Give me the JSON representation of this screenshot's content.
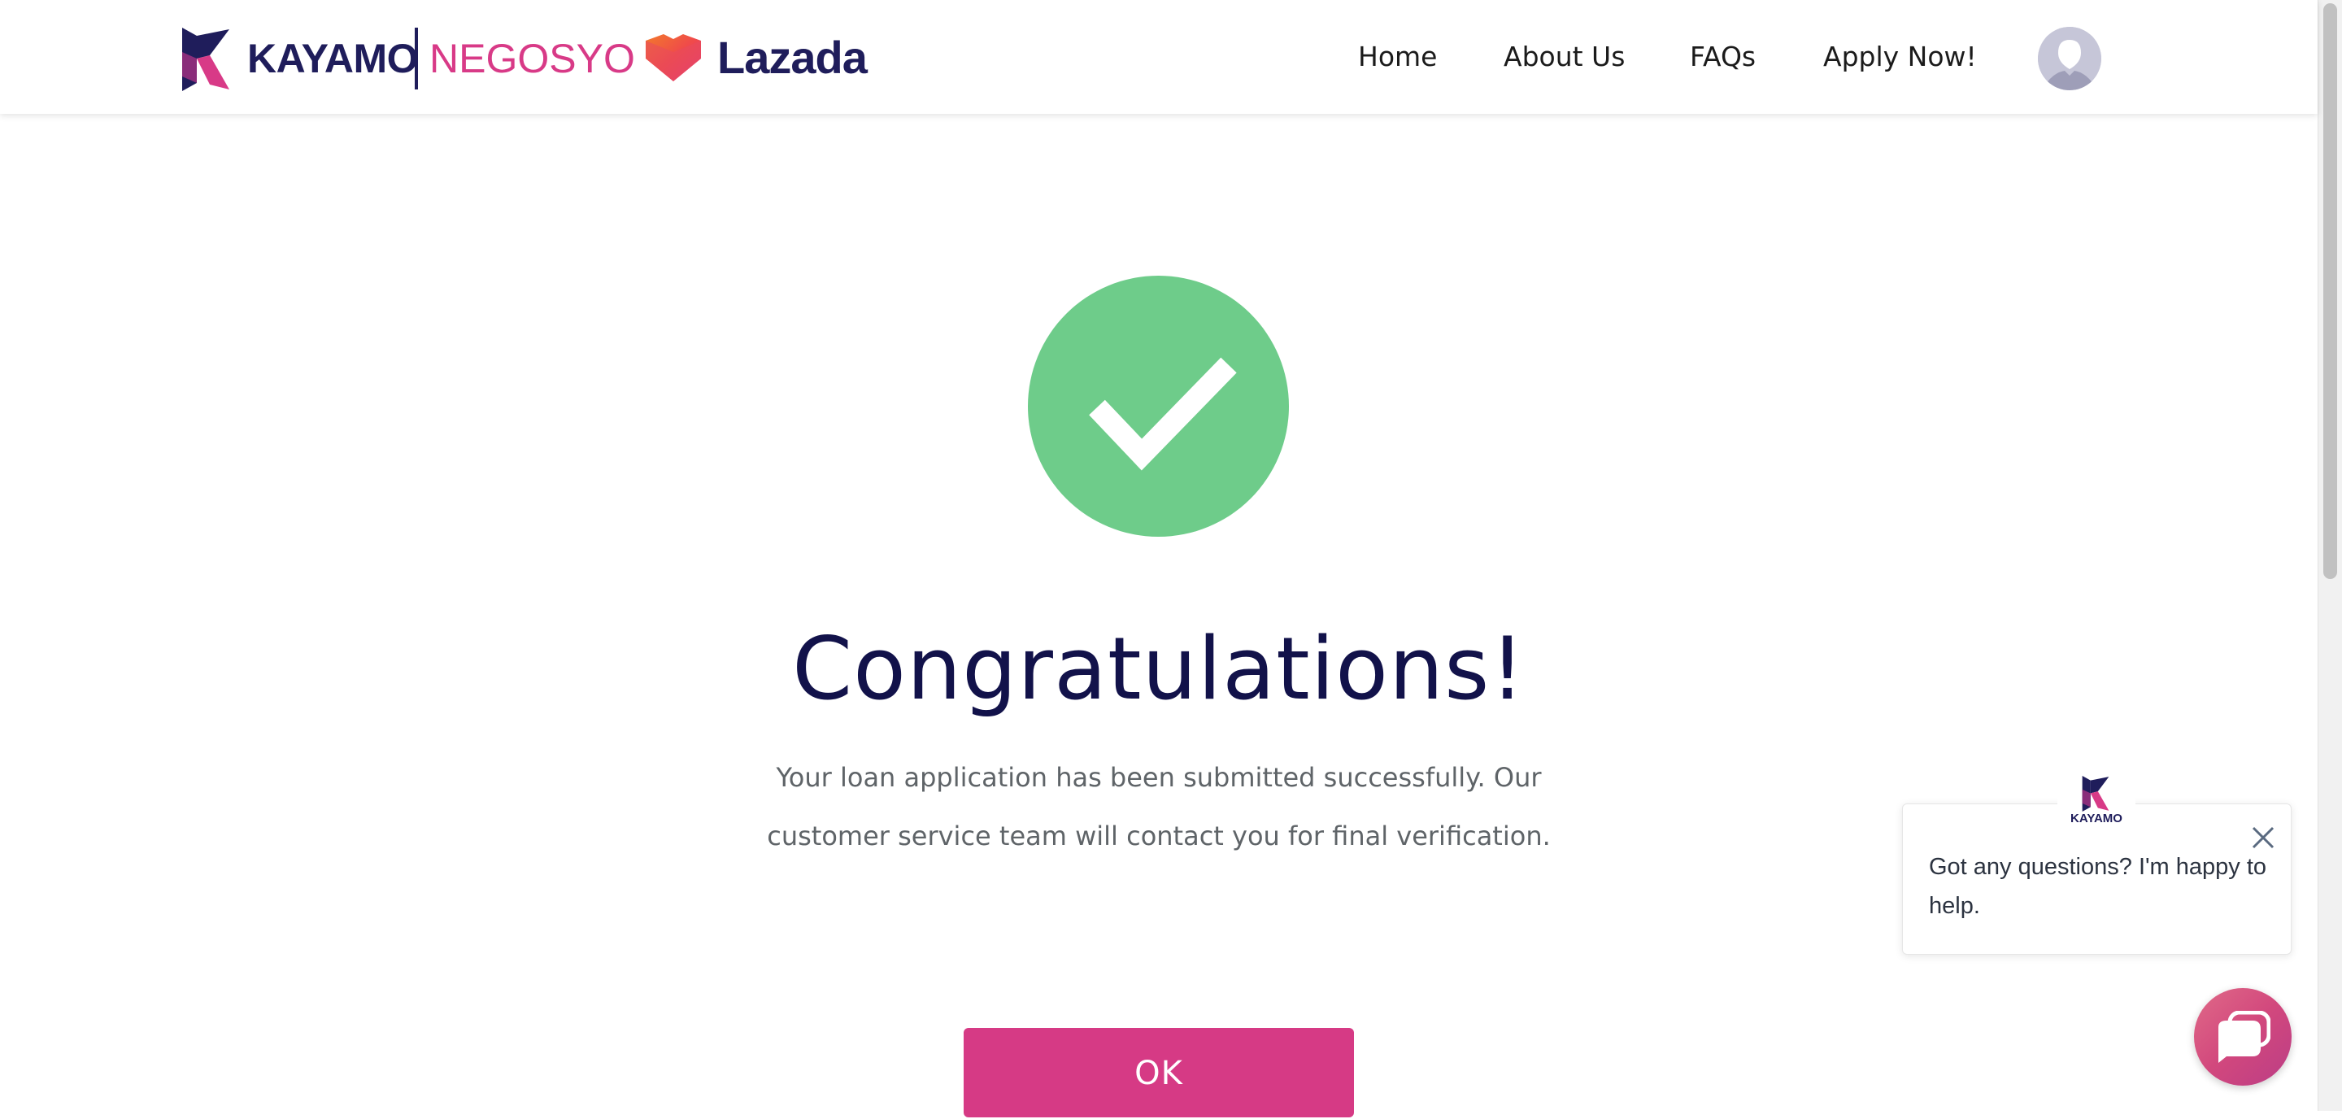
{
  "header": {
    "brand": {
      "kayamo": "KAYAMO",
      "negosyo": "NEGOSYO",
      "partner": "Lazada"
    },
    "nav": [
      {
        "label": "Home"
      },
      {
        "label": "About Us"
      },
      {
        "label": "FAQs"
      },
      {
        "label": "Apply Now!"
      }
    ],
    "avatar_icon": "user-avatar-icon"
  },
  "main": {
    "status_icon": "check-icon",
    "title": "Congratulations!",
    "message_line1": "Your loan application has been submitted successfully. Our",
    "message_line2": "customer service team will contact you for final verification.",
    "ok_label": "OK"
  },
  "chat": {
    "logo_text": "KAYAMO",
    "message_line1": "Got any questions? I'm happy to",
    "message_line2": "help.",
    "close_icon": "close-icon",
    "launcher_icon": "chat-icon"
  },
  "colors": {
    "brand_navy": "#1f1d5b",
    "brand_pink": "#d83a87",
    "success_green": "#6ecc8a",
    "button_pink": "#d63a85",
    "title_navy": "#12124a"
  }
}
